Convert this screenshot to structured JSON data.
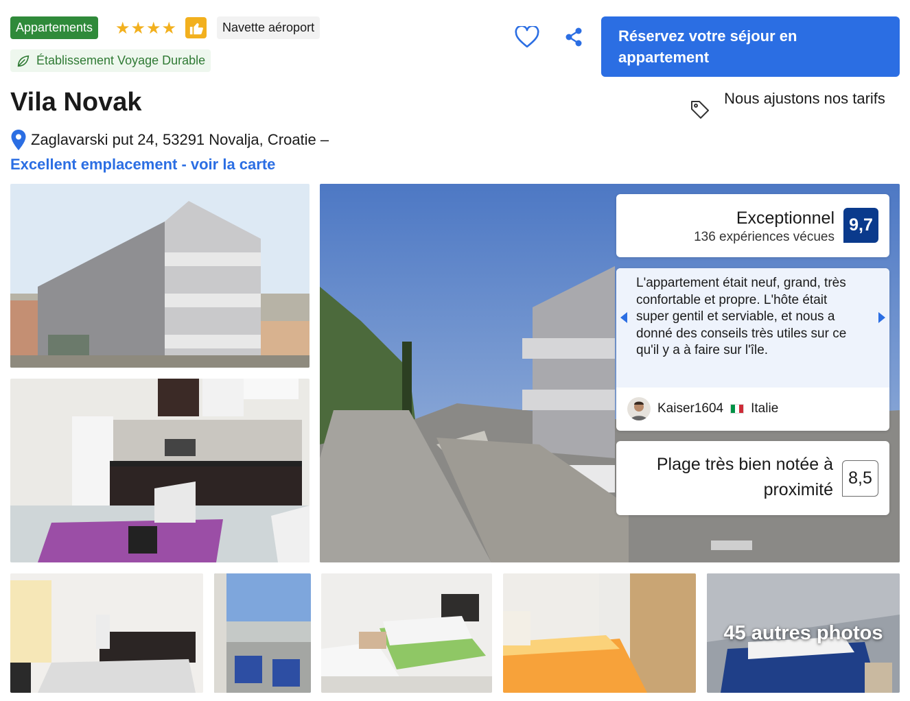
{
  "badges": {
    "property_type": "Appartements",
    "stars": 4,
    "star_glyph": "★",
    "preferred_icon": "thumbs-up-icon",
    "shuttle": "Navette aéroport",
    "sustainable": "Établissement Voyage Durable"
  },
  "actions": {
    "favorite_icon": "heart-icon",
    "share_icon": "share-icon",
    "reserve_label": "Réservez votre séjour en appartement"
  },
  "price_match": {
    "icon": "tag-icon",
    "label": "Nous ajustons nos tarifs"
  },
  "property": {
    "name": "Vila Novak",
    "address": "Zaglavarski put 24, 53291 Novalja, Croatie –",
    "map_link": "Excellent emplacement - voir la carte"
  },
  "rating": {
    "label": "Exceptionnel",
    "count": "136 expériences vécues",
    "score": "9,7"
  },
  "review": {
    "text": "L'appartement était neuf, grand, très confortable et propre. L'hôte était super gentil et serviable, et nous a donné des conseils très utiles sur ce qu'il y a à faire sur l'île.",
    "reviewer": "Kaiser1604",
    "country": "Italie"
  },
  "beach": {
    "label": "Plage très bien notée à proximité",
    "score": "8,5"
  },
  "gallery": {
    "more_photos": "45 autres photos"
  },
  "colors": {
    "brand_blue": "#2b6ee3",
    "score_navy": "#0a3a8c",
    "green_badge": "#2f8a3a",
    "star_yellow": "#f2b01e"
  }
}
